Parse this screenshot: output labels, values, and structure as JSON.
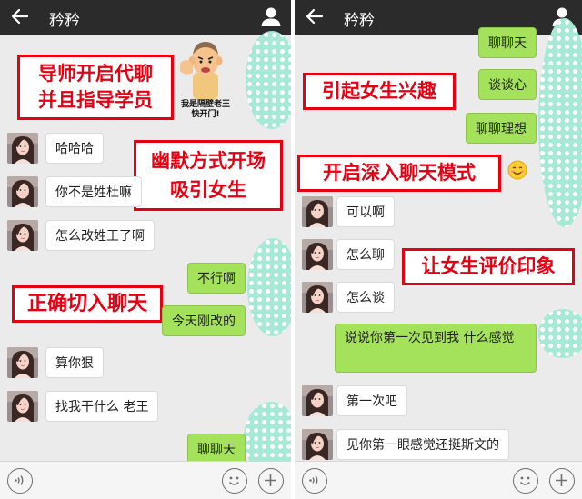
{
  "chat_title": "矜矜",
  "left": {
    "captions": {
      "sticker_line1": "我是隔壁老王",
      "sticker_line2": "快开门!",
      "overlay_mentor": "导师开启代聊 并且指导学员",
      "overlay_humor": "幽默方式开场 吸引女生",
      "overlay_entry": "正确切入聊天"
    },
    "messages": [
      {
        "side": "in",
        "text": "哈哈哈"
      },
      {
        "side": "in",
        "text": "你不是姓杜嘛"
      },
      {
        "side": "in",
        "text": "怎么改姓王了啊"
      },
      {
        "side": "out",
        "text": "不行啊"
      },
      {
        "side": "out",
        "text": "今天刚改的"
      },
      {
        "side": "in",
        "text": "算你狠"
      },
      {
        "side": "in",
        "text": "找我干什么 老王"
      },
      {
        "side": "out",
        "text": "聊聊天"
      }
    ]
  },
  "right": {
    "captions": {
      "overlay_interest": "引起女生兴趣",
      "overlay_deep": "开启深入聊天模式",
      "overlay_impression": "让女生评价印象"
    },
    "messages": [
      {
        "side": "out",
        "text": "聊聊天"
      },
      {
        "side": "out",
        "text": "谈谈心"
      },
      {
        "side": "out",
        "text": "聊聊理想"
      },
      {
        "side": "in",
        "text": "可以啊"
      },
      {
        "side": "in",
        "text": "怎么聊"
      },
      {
        "side": "in",
        "text": "怎么谈"
      },
      {
        "side": "out",
        "text": "说说你第一次见到我 什么感觉"
      },
      {
        "side": "in",
        "text": "第一次吧"
      },
      {
        "side": "in",
        "text": "见你第一眼感觉还挺斯文的"
      }
    ]
  },
  "icons": {
    "back": "back-arrow-icon",
    "user": "user-profile-icon",
    "voice": "voice-input-icon",
    "emoji": "emoji-icon",
    "plus": "plus-icon",
    "smile": "smiling-face-emoji"
  },
  "colors": {
    "topbar": "#2b2b2b",
    "chat_bg": "#ebebeb",
    "bubble_out": "#a4e25c",
    "bubble_in": "#ffffff",
    "overlay_red": "#e60012",
    "mint_dots": "#a6ead6"
  }
}
